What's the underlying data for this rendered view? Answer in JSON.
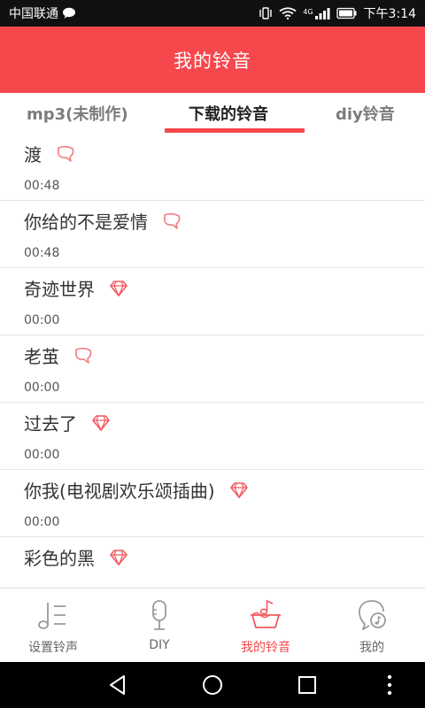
{
  "status": {
    "carrier": "中国联通",
    "time": "下午3:14",
    "network_label": "4G"
  },
  "header": {
    "title": "我的铃音"
  },
  "tabs": [
    {
      "label": "mp3(未制作)",
      "active": false
    },
    {
      "label": "下载的铃音",
      "active": true
    },
    {
      "label": "diy铃音",
      "active": false
    }
  ],
  "ringtones": [
    {
      "name": "渡",
      "duration": "00:48",
      "badge": "bubble-icon"
    },
    {
      "name": "你给的不是爱情",
      "duration": "00:48",
      "badge": "bubble-icon"
    },
    {
      "name": "奇迹世界",
      "duration": "00:00",
      "badge": "diamond-icon"
    },
    {
      "name": "老茧",
      "duration": "00:00",
      "badge": "bubble-icon"
    },
    {
      "name": "过去了",
      "duration": "00:00",
      "badge": "diamond-icon"
    },
    {
      "name": "你我(电视剧欢乐颂插曲)",
      "duration": "00:00",
      "badge": "diamond-icon"
    },
    {
      "name": "彩色的黑",
      "duration": "",
      "badge": "diamond-icon"
    }
  ],
  "bottom_nav": [
    {
      "label": "设置铃声",
      "icon": "music-note-icon",
      "active": false
    },
    {
      "label": "DIY",
      "icon": "microphone-icon",
      "active": false
    },
    {
      "label": "我的铃音",
      "icon": "music-box-icon",
      "active": true
    },
    {
      "label": "我的",
      "icon": "user-music-icon",
      "active": false
    }
  ],
  "colors": {
    "accent": "#f6474d",
    "text_primary": "#333333",
    "text_secondary": "#555555",
    "tab_inactive": "#7c7c7c",
    "nav_inactive": "#666666"
  }
}
